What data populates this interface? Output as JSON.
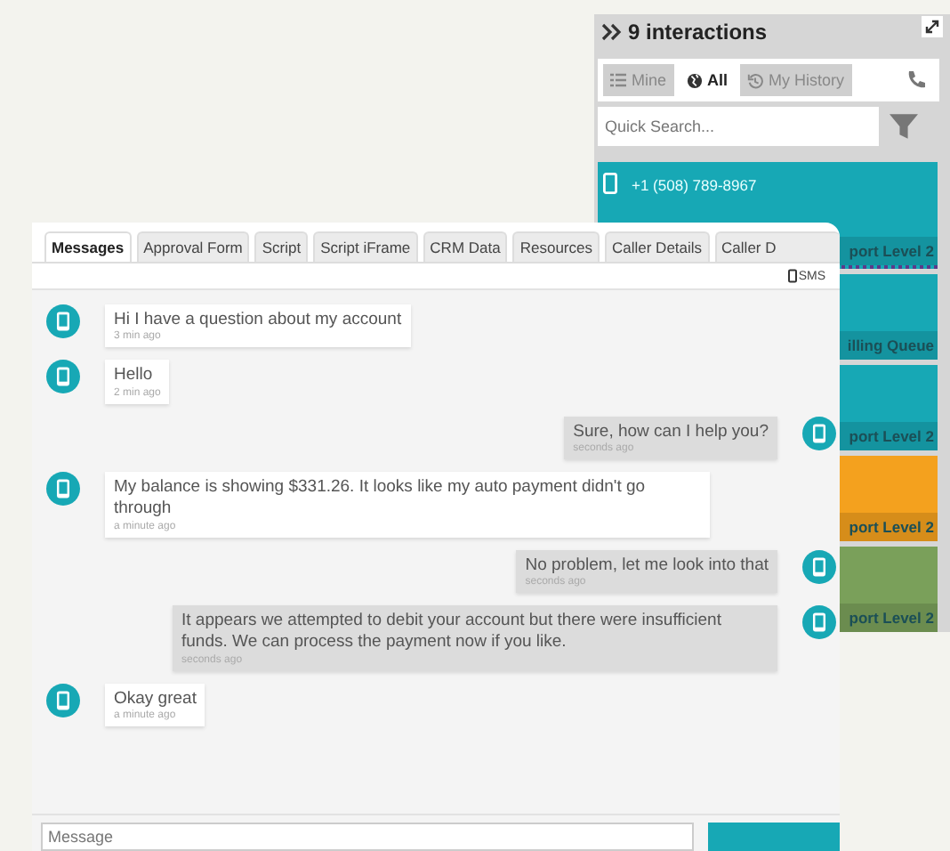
{
  "queue_panel": {
    "title": "9 interactions",
    "filters": [
      {
        "label": "Mine",
        "selected": false
      },
      {
        "label": "All",
        "selected": true
      },
      {
        "label": "My History",
        "selected": false
      }
    ],
    "search": {
      "placeholder": "Quick Search..."
    },
    "cards": [
      {
        "phone": "+1 (508) 789-8967",
        "queue": "port Level 2",
        "color": "#17a8b5"
      },
      {
        "queue": "illing Queue",
        "color": "#17a8b5"
      },
      {
        "queue": "port Level 2",
        "color": "#17a8b5"
      },
      {
        "queue": "port Level 2",
        "color": "#f4a11e"
      },
      {
        "queue": "port Level 2",
        "color": "#7aa05a"
      }
    ]
  },
  "chat": {
    "tabs": [
      {
        "label": "Messages",
        "selected": true
      },
      {
        "label": "Approval Form",
        "selected": false
      },
      {
        "label": "Script",
        "selected": false
      },
      {
        "label": "Script iFrame",
        "selected": false
      },
      {
        "label": "CRM Data",
        "selected": false
      },
      {
        "label": "Resources",
        "selected": false
      },
      {
        "label": "Caller Details",
        "selected": false
      },
      {
        "label": "Caller D",
        "selected": false
      }
    ],
    "channel": "SMS",
    "messages": [
      {
        "kind": "incoming",
        "text": "Hi I have a question about my account",
        "time": "3 min ago"
      },
      {
        "kind": "incoming",
        "text": "Hello",
        "time": "2 min ago"
      },
      {
        "kind": "outgoing",
        "text": "Sure, how can I help you?",
        "time": "seconds ago"
      },
      {
        "kind": "incoming",
        "text": "My balance is showing $331.26. It looks like my auto payment didn't go through",
        "time": "a minute ago"
      },
      {
        "kind": "outgoing",
        "text": "No problem, let me look into that",
        "time": "seconds ago"
      },
      {
        "kind": "outgoing",
        "text": "It appears we attempted to debit your account but there were insufficient funds. We can process the payment now if you like.",
        "time": "seconds ago"
      },
      {
        "kind": "incoming",
        "text": "Okay great",
        "time": "a minute ago"
      }
    ],
    "composer": {
      "placeholder": "Message"
    }
  }
}
